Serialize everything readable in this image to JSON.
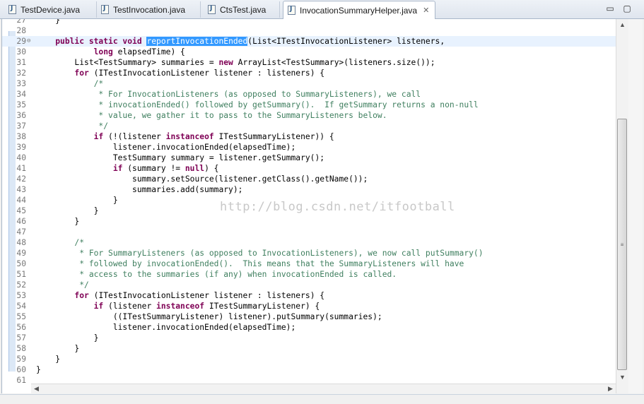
{
  "tabs": [
    {
      "label": "TestDevice.java",
      "active": false
    },
    {
      "label": "TestInvocation.java",
      "active": false
    },
    {
      "label": "CtsTest.java",
      "active": false
    },
    {
      "label": "InvocationSummaryHelper.java",
      "active": true
    }
  ],
  "tab_close_symbol": "✕",
  "window_controls": {
    "minimize": "▭",
    "maximize": "▢"
  },
  "watermark": "http://blog.csdn.net/itfootball",
  "colors": {
    "keyword": "#7f0055",
    "comment": "#3f7f5f",
    "selection": "#3399ff",
    "current_line": "#e8f2fe"
  },
  "lines": [
    {
      "num": "27",
      "segments": [
        {
          "t": "    }"
        }
      ]
    },
    {
      "num": "28",
      "segments": [
        {
          "t": ""
        }
      ]
    },
    {
      "num": "29",
      "fold": "⊖",
      "current": true,
      "segments": [
        {
          "t": "    "
        },
        {
          "t": "public static void ",
          "c": "kw"
        },
        {
          "t": "reportInvocationEnded",
          "c": "sel"
        },
        {
          "t": "(List<ITestInvocationListener> listeners,"
        }
      ]
    },
    {
      "num": "30",
      "segments": [
        {
          "t": "            "
        },
        {
          "t": "long ",
          "c": "kw"
        },
        {
          "t": "elapsedTime) {"
        }
      ]
    },
    {
      "num": "31",
      "segments": [
        {
          "t": "        List<TestSummary> summaries = "
        },
        {
          "t": "new ",
          "c": "kw"
        },
        {
          "t": "ArrayList<TestSummary>(listeners.size());"
        }
      ]
    },
    {
      "num": "32",
      "segments": [
        {
          "t": "        "
        },
        {
          "t": "for ",
          "c": "kw"
        },
        {
          "t": "(ITestInvocationListener listener : listeners) {"
        }
      ]
    },
    {
      "num": "33",
      "segments": [
        {
          "t": "            "
        },
        {
          "t": "/*",
          "c": "cm"
        }
      ]
    },
    {
      "num": "34",
      "segments": [
        {
          "t": "             * For InvocationListeners (as opposed to SummaryListeners), we call",
          "c": "cm"
        }
      ]
    },
    {
      "num": "35",
      "segments": [
        {
          "t": "             * invocationEnded() followed by getSummary().  If getSummary returns a non-null",
          "c": "cm"
        }
      ]
    },
    {
      "num": "36",
      "segments": [
        {
          "t": "             * value, we gather it to pass to the SummaryListeners below.",
          "c": "cm"
        }
      ]
    },
    {
      "num": "37",
      "segments": [
        {
          "t": "             */",
          "c": "cm"
        }
      ]
    },
    {
      "num": "38",
      "segments": [
        {
          "t": "            "
        },
        {
          "t": "if ",
          "c": "kw"
        },
        {
          "t": "(!(listener "
        },
        {
          "t": "instanceof ",
          "c": "kw"
        },
        {
          "t": "ITestSummaryListener)) {"
        }
      ]
    },
    {
      "num": "39",
      "segments": [
        {
          "t": "                listener.invocationEnded(elapsedTime);"
        }
      ]
    },
    {
      "num": "40",
      "segments": [
        {
          "t": "                TestSummary summary = listener.getSummary();"
        }
      ]
    },
    {
      "num": "41",
      "segments": [
        {
          "t": "                "
        },
        {
          "t": "if ",
          "c": "kw"
        },
        {
          "t": "(summary != "
        },
        {
          "t": "null",
          "c": "kw"
        },
        {
          "t": ") {"
        }
      ]
    },
    {
      "num": "42",
      "segments": [
        {
          "t": "                    summary.setSource(listener.getClass().getName());"
        }
      ]
    },
    {
      "num": "43",
      "segments": [
        {
          "t": "                    summaries.add(summary);"
        }
      ]
    },
    {
      "num": "44",
      "segments": [
        {
          "t": "                }"
        }
      ]
    },
    {
      "num": "45",
      "segments": [
        {
          "t": "            }"
        }
      ]
    },
    {
      "num": "46",
      "segments": [
        {
          "t": "        }"
        }
      ]
    },
    {
      "num": "47",
      "segments": [
        {
          "t": ""
        }
      ]
    },
    {
      "num": "48",
      "segments": [
        {
          "t": "        "
        },
        {
          "t": "/*",
          "c": "cm"
        }
      ]
    },
    {
      "num": "49",
      "segments": [
        {
          "t": "         * For SummaryListeners (as opposed to InvocationListeners), we now call putSummary()",
          "c": "cm"
        }
      ]
    },
    {
      "num": "50",
      "segments": [
        {
          "t": "         * followed by invocationEnded().  This means that the SummaryListeners will have",
          "c": "cm"
        }
      ]
    },
    {
      "num": "51",
      "segments": [
        {
          "t": "         * access to the summaries (if any) when invocationEnded is called.",
          "c": "cm"
        }
      ]
    },
    {
      "num": "52",
      "segments": [
        {
          "t": "         */",
          "c": "cm"
        }
      ]
    },
    {
      "num": "53",
      "segments": [
        {
          "t": "        "
        },
        {
          "t": "for ",
          "c": "kw"
        },
        {
          "t": "(ITestInvocationListener listener : listeners) {"
        }
      ]
    },
    {
      "num": "54",
      "segments": [
        {
          "t": "            "
        },
        {
          "t": "if ",
          "c": "kw"
        },
        {
          "t": "(listener "
        },
        {
          "t": "instanceof ",
          "c": "kw"
        },
        {
          "t": "ITestSummaryListener) {"
        }
      ]
    },
    {
      "num": "55",
      "segments": [
        {
          "t": "                ((ITestSummaryListener) listener).putSummary(summaries);"
        }
      ]
    },
    {
      "num": "56",
      "segments": [
        {
          "t": "                listener.invocationEnded(elapsedTime);"
        }
      ]
    },
    {
      "num": "57",
      "segments": [
        {
          "t": "            }"
        }
      ]
    },
    {
      "num": "58",
      "segments": [
        {
          "t": "        }"
        }
      ]
    },
    {
      "num": "59",
      "segments": [
        {
          "t": "    }"
        }
      ]
    },
    {
      "num": "60",
      "segments": [
        {
          "t": "}"
        }
      ]
    },
    {
      "num": "61",
      "segments": [
        {
          "t": ""
        }
      ]
    }
  ]
}
